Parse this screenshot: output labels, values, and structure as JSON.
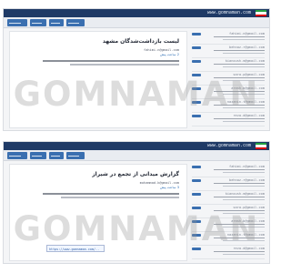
{
  "watermark": "GOMNAMAN",
  "posts": [
    {
      "url": "www.gomnaman.com",
      "title": "لیست بازداشت‌شدگان مشهد",
      "email": "fahimi.n@gmail.com",
      "time": "2 ساعت پیش",
      "sidebar": [
        {
          "email": "fahimi.n@gmail.com"
        },
        {
          "email": "behnaz.r@gmail.com"
        },
        {
          "email": "kianoush.m@gmail.com"
        },
        {
          "email": "sara.p@gmail.com"
        },
        {
          "email": "arash.b@gmail.com"
        },
        {
          "email": "nazanin.t@gmail.com"
        },
        {
          "email": "reza.d@gmail.com"
        }
      ]
    },
    {
      "url": "www.gomnaman.com",
      "title": "گزارش میدانی از تجمع در شیراز",
      "email": "mohammad.k@gmail.com",
      "time": "3 ساعت پیش",
      "link": "https://www.gomnaman.com/..",
      "sidebar": [
        {
          "email": "fahimi.n@gmail.com"
        },
        {
          "email": "behnaz.r@gmail.com"
        },
        {
          "email": "kianoush.m@gmail.com"
        },
        {
          "email": "sara.p@gmail.com"
        },
        {
          "email": "arash.b@gmail.com"
        },
        {
          "email": "nazanin.t@gmail.com"
        },
        {
          "email": "reza.d@gmail.com"
        }
      ]
    }
  ]
}
